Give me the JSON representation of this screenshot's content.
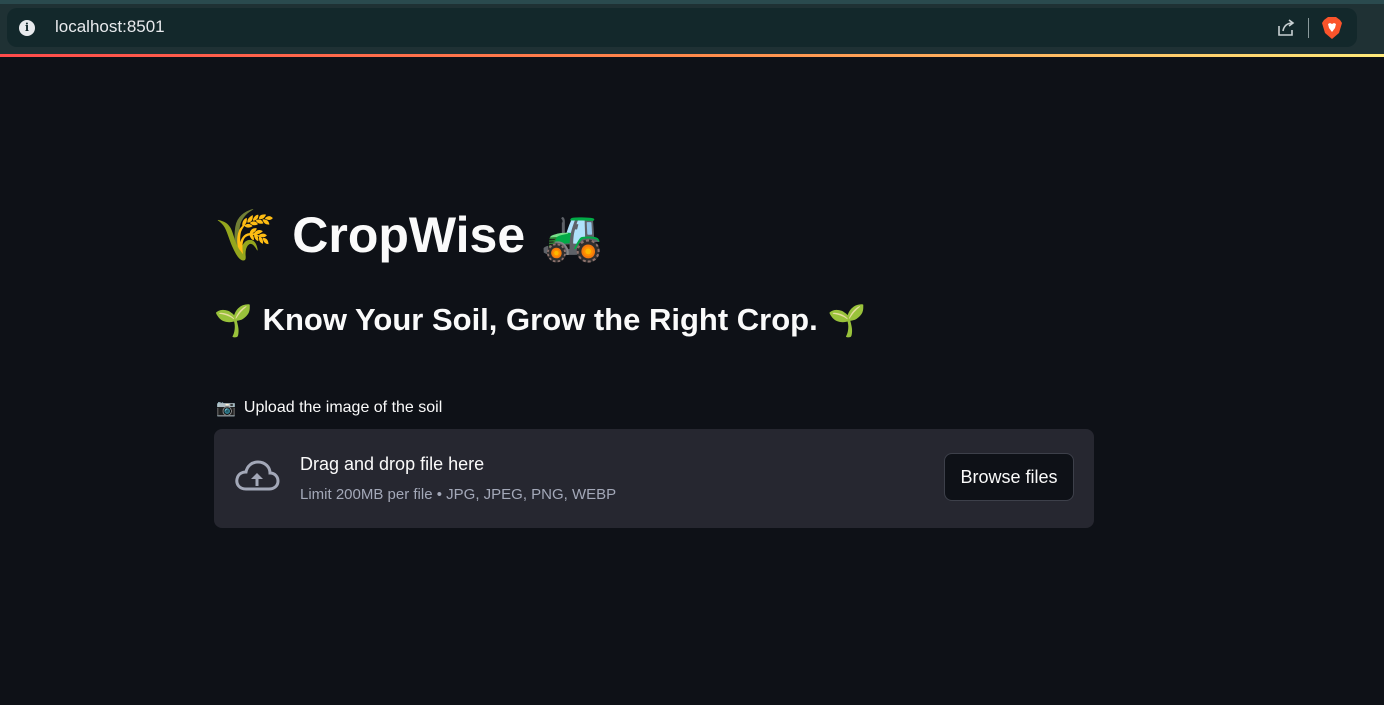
{
  "browser": {
    "url": "localhost:8501",
    "info_icon": "i"
  },
  "app": {
    "title": "CropWise",
    "title_emoji_left": "🌾",
    "title_emoji_right": "🚜",
    "subtitle": "Know Your Soil, Grow the Right Crop.",
    "subtitle_emoji": "🌱"
  },
  "uploader": {
    "label": "Upload the image of the soil",
    "label_emoji": "📷",
    "drop_title": "Drag and drop file here",
    "drop_subtitle": "Limit 200MB per file • JPG, JPEG, PNG, WEBP",
    "browse_label": "Browse files"
  },
  "colors": {
    "background": "#0e1117",
    "dropzone": "#262730",
    "accent_stripe_start": "#ff4b4b",
    "accent_stripe_end": "#ffea7a"
  }
}
